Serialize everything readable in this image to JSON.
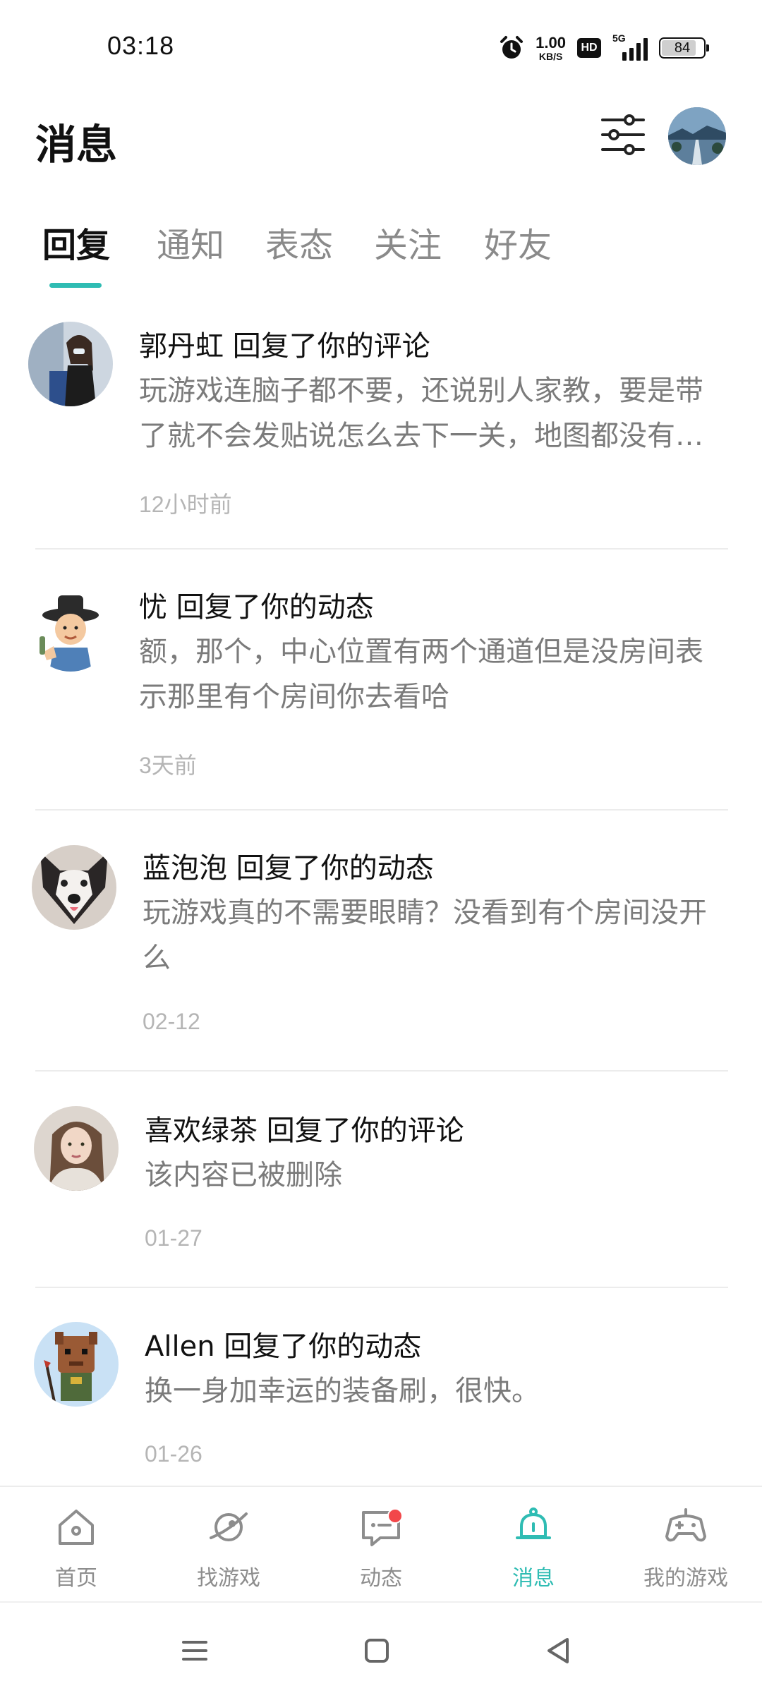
{
  "status_bar": {
    "time": "03:18",
    "net_speed_value": "1.00",
    "net_speed_unit": "KB/S",
    "hd_label": "HD",
    "network_label": "5G",
    "battery_percent": "84",
    "battery_level": 0.84
  },
  "header": {
    "title": "消息",
    "filter_icon": "sliders-icon",
    "avatar_icon": "road-landscape-avatar"
  },
  "tabs": [
    {
      "label": "回复",
      "active": true
    },
    {
      "label": "通知",
      "active": false
    },
    {
      "label": "表态",
      "active": false
    },
    {
      "label": "关注",
      "active": false
    },
    {
      "label": "好友",
      "active": false
    }
  ],
  "messages": [
    {
      "title": "郭丹虹 回复了你的评论",
      "body": "玩游戏连脑子都不要，还说别人家教，要是带了就不会发贴说怎么去下一关，地图都没有看吗",
      "time": "12小时前",
      "avatar": "woman-photo-avatar"
    },
    {
      "title": "忧 回复了你的动态",
      "body": "额，那个，中心位置有两个通道但是没房间表示那里有个房间你去看哈",
      "time": "3天前",
      "avatar": "cartoon-scholar-avatar"
    },
    {
      "title": "蓝泡泡 回复了你的动态",
      "body": "玩游戏真的不需要眼睛？没看到有个房间没开么",
      "time": "02-12",
      "avatar": "husky-dog-avatar"
    },
    {
      "title": "喜欢绿茶 回复了你的评论",
      "body": "该内容已被删除",
      "time": "01-27",
      "avatar": "girl-portrait-avatar"
    },
    {
      "title": "Allen 回复了你的动态",
      "body": "换一身加幸运的装备刷，很快。",
      "time": "01-26",
      "avatar": "brick-figure-avatar"
    }
  ],
  "bottom_nav": [
    {
      "label": "首页",
      "icon": "home-icon",
      "active": false
    },
    {
      "label": "找游戏",
      "icon": "planet-icon",
      "active": false
    },
    {
      "label": "动态",
      "icon": "chat-icon",
      "active": false,
      "badge": true
    },
    {
      "label": "消息",
      "icon": "bell-icon",
      "active": true
    },
    {
      "label": "我的游戏",
      "icon": "gamepad-icon",
      "active": false
    }
  ],
  "colors": {
    "accent": "#2fbcb3",
    "badge": "#f2474a",
    "text_primary": "#111111",
    "text_secondary": "#7b7b7b",
    "text_tertiary": "#b5b5b5"
  },
  "system_nav": {
    "menu_icon": "menu-icon",
    "home_icon": "square-home-icon",
    "back_icon": "back-triangle-icon"
  }
}
